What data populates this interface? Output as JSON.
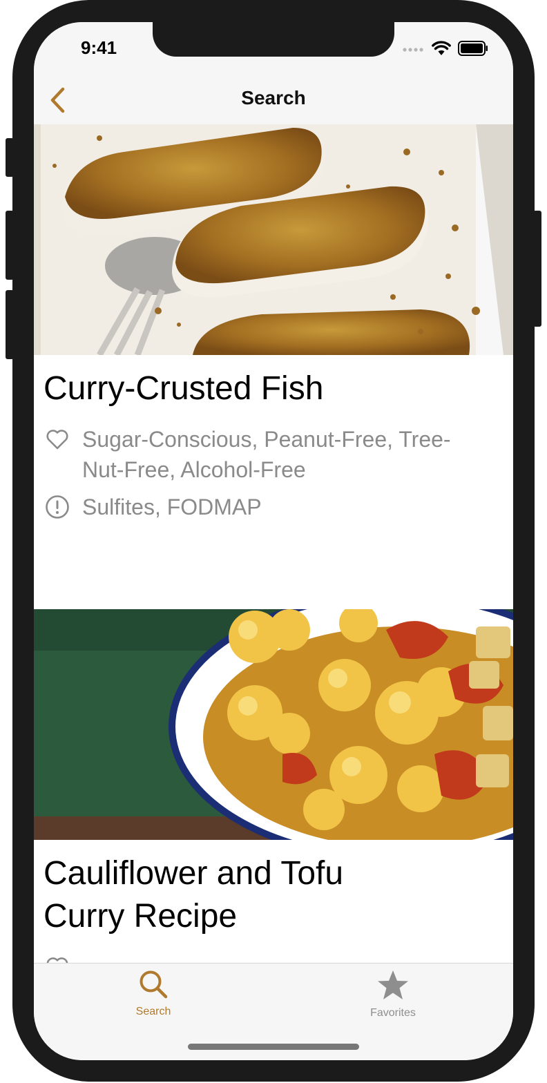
{
  "status": {
    "time": "9:41"
  },
  "nav": {
    "title": "Search"
  },
  "recipes": [
    {
      "title": "Curry-Crusted Fish",
      "health_labels": "Sugar-Conscious, Peanut-Free, Tree-Nut-Free, Alcohol-Free",
      "cautions": "Sulfites, FODMAP"
    },
    {
      "title": "Cauliflower and Tofu Curry Recipe"
    }
  ],
  "tabs": [
    {
      "label": "Search",
      "icon": "search-icon",
      "active": true
    },
    {
      "label": "Favorites",
      "icon": "star-icon",
      "active": false
    }
  ],
  "colors": {
    "accent": "#b07a2e",
    "inactive": "#8e8e8e",
    "secondary_text": "#8a8a8a"
  }
}
